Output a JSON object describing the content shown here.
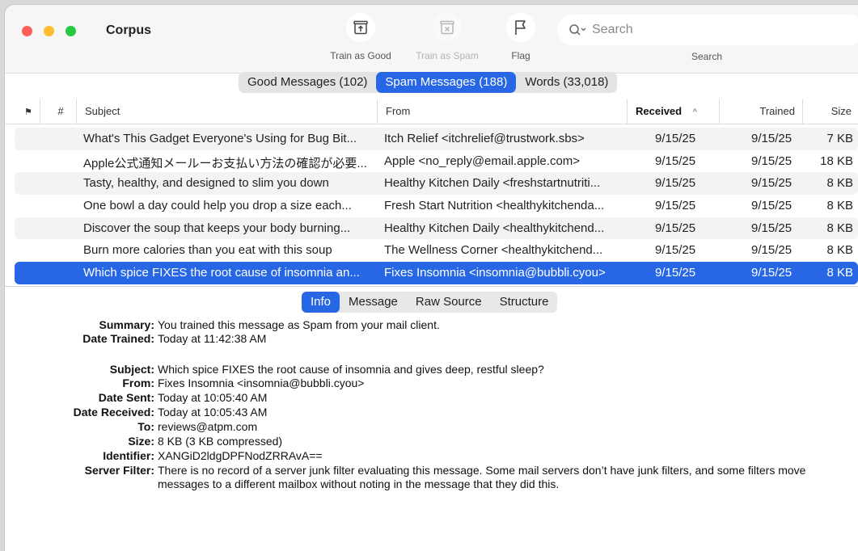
{
  "app": {
    "title": "Corpus"
  },
  "traffic_lights": {
    "close": "#fe5f57",
    "minimize": "#febc2e",
    "zoom": "#28c840"
  },
  "toolbar": {
    "train_good": {
      "label": "Train as Good",
      "icon": "tray-up-icon"
    },
    "train_spam": {
      "label": "Train as Spam",
      "icon": "tray-x-icon"
    },
    "flag": {
      "label": "Flag",
      "icon": "flag-icon"
    },
    "search": {
      "placeholder": "Search",
      "label": "Search"
    }
  },
  "segments": [
    "Good Messages (102)",
    "Spam Messages (188)",
    "Words (33,018)"
  ],
  "columns": {
    "flag": "⚑",
    "num": "#",
    "subject": "Subject",
    "from": "From",
    "received": "Received",
    "sort_indicator": "^",
    "trained": "Trained",
    "size": "Size"
  },
  "messages": [
    {
      "subject": "What's This Gadget Everyone's Using for Bug Bit...",
      "from": "Itch Relief <itchrelief@trustwork.sbs>",
      "received": "9/15/25",
      "trained": "9/15/25",
      "size": "7 KB"
    },
    {
      "subject": "Apple公式通知メールーお支払い方法の確認が必要...",
      "from": "Apple <no_reply@email.apple.com>",
      "received": "9/15/25",
      "trained": "9/15/25",
      "size": "18 KB"
    },
    {
      "subject": "Tasty, healthy, and designed to slim you down",
      "from": "Healthy Kitchen Daily <freshstartnutriti...",
      "received": "9/15/25",
      "trained": "9/15/25",
      "size": "8 KB"
    },
    {
      "subject": "One bowl a day could help you drop a size each...",
      "from": "Fresh Start Nutrition <healthykitchenda...",
      "received": "9/15/25",
      "trained": "9/15/25",
      "size": "8 KB"
    },
    {
      "subject": "Discover the soup that keeps your body burning...",
      "from": "Healthy Kitchen Daily <healthykitchend...",
      "received": "9/15/25",
      "trained": "9/15/25",
      "size": "8 KB"
    },
    {
      "subject": "Burn more calories than you eat with this soup",
      "from": "The Wellness Corner <healthykitchend...",
      "received": "9/15/25",
      "trained": "9/15/25",
      "size": "8 KB"
    },
    {
      "subject": "Which spice FIXES the root cause of insomnia an...",
      "from": "Fixes Insomnia <insomnia@bubbli.cyou>",
      "received": "9/15/25",
      "trained": "9/15/25",
      "size": "8 KB"
    }
  ],
  "detail_tabs": [
    "Info",
    "Message",
    "Raw Source",
    "Structure"
  ],
  "info": {
    "summary": {
      "label": "Summary:",
      "value": "You trained this message as Spam from your mail client."
    },
    "date_trained": {
      "label": "Date Trained:",
      "value": "Today at 11:42:38 AM"
    },
    "subject": {
      "label": "Subject:",
      "value": "Which spice FIXES the root cause of insomnia and gives deep, restful sleep?"
    },
    "from": {
      "label": "From:",
      "value": "Fixes Insomnia <insomnia@bubbli.cyou>"
    },
    "date_sent": {
      "label": "Date Sent:",
      "value": "Today at 10:05:40 AM"
    },
    "date_received": {
      "label": "Date Received:",
      "value": "Today at 10:05:43 AM"
    },
    "to": {
      "label": "To:",
      "value": "reviews@atpm.com"
    },
    "size": {
      "label": "Size:",
      "value": "8 KB (3 KB compressed)"
    },
    "identifier": {
      "label": "Identifier:",
      "value": "XANGiD2ldgDPFNodZRRAvA=="
    },
    "server_filter": {
      "label": "Server Filter:",
      "value": "There is no record of a server junk filter evaluating this message. Some mail servers don’t have junk filters, and some filters move messages to a different mailbox without noting in the message that they did this."
    }
  },
  "colors": {
    "accent": "#2767e6",
    "row_alt": "#f3f3f3"
  }
}
